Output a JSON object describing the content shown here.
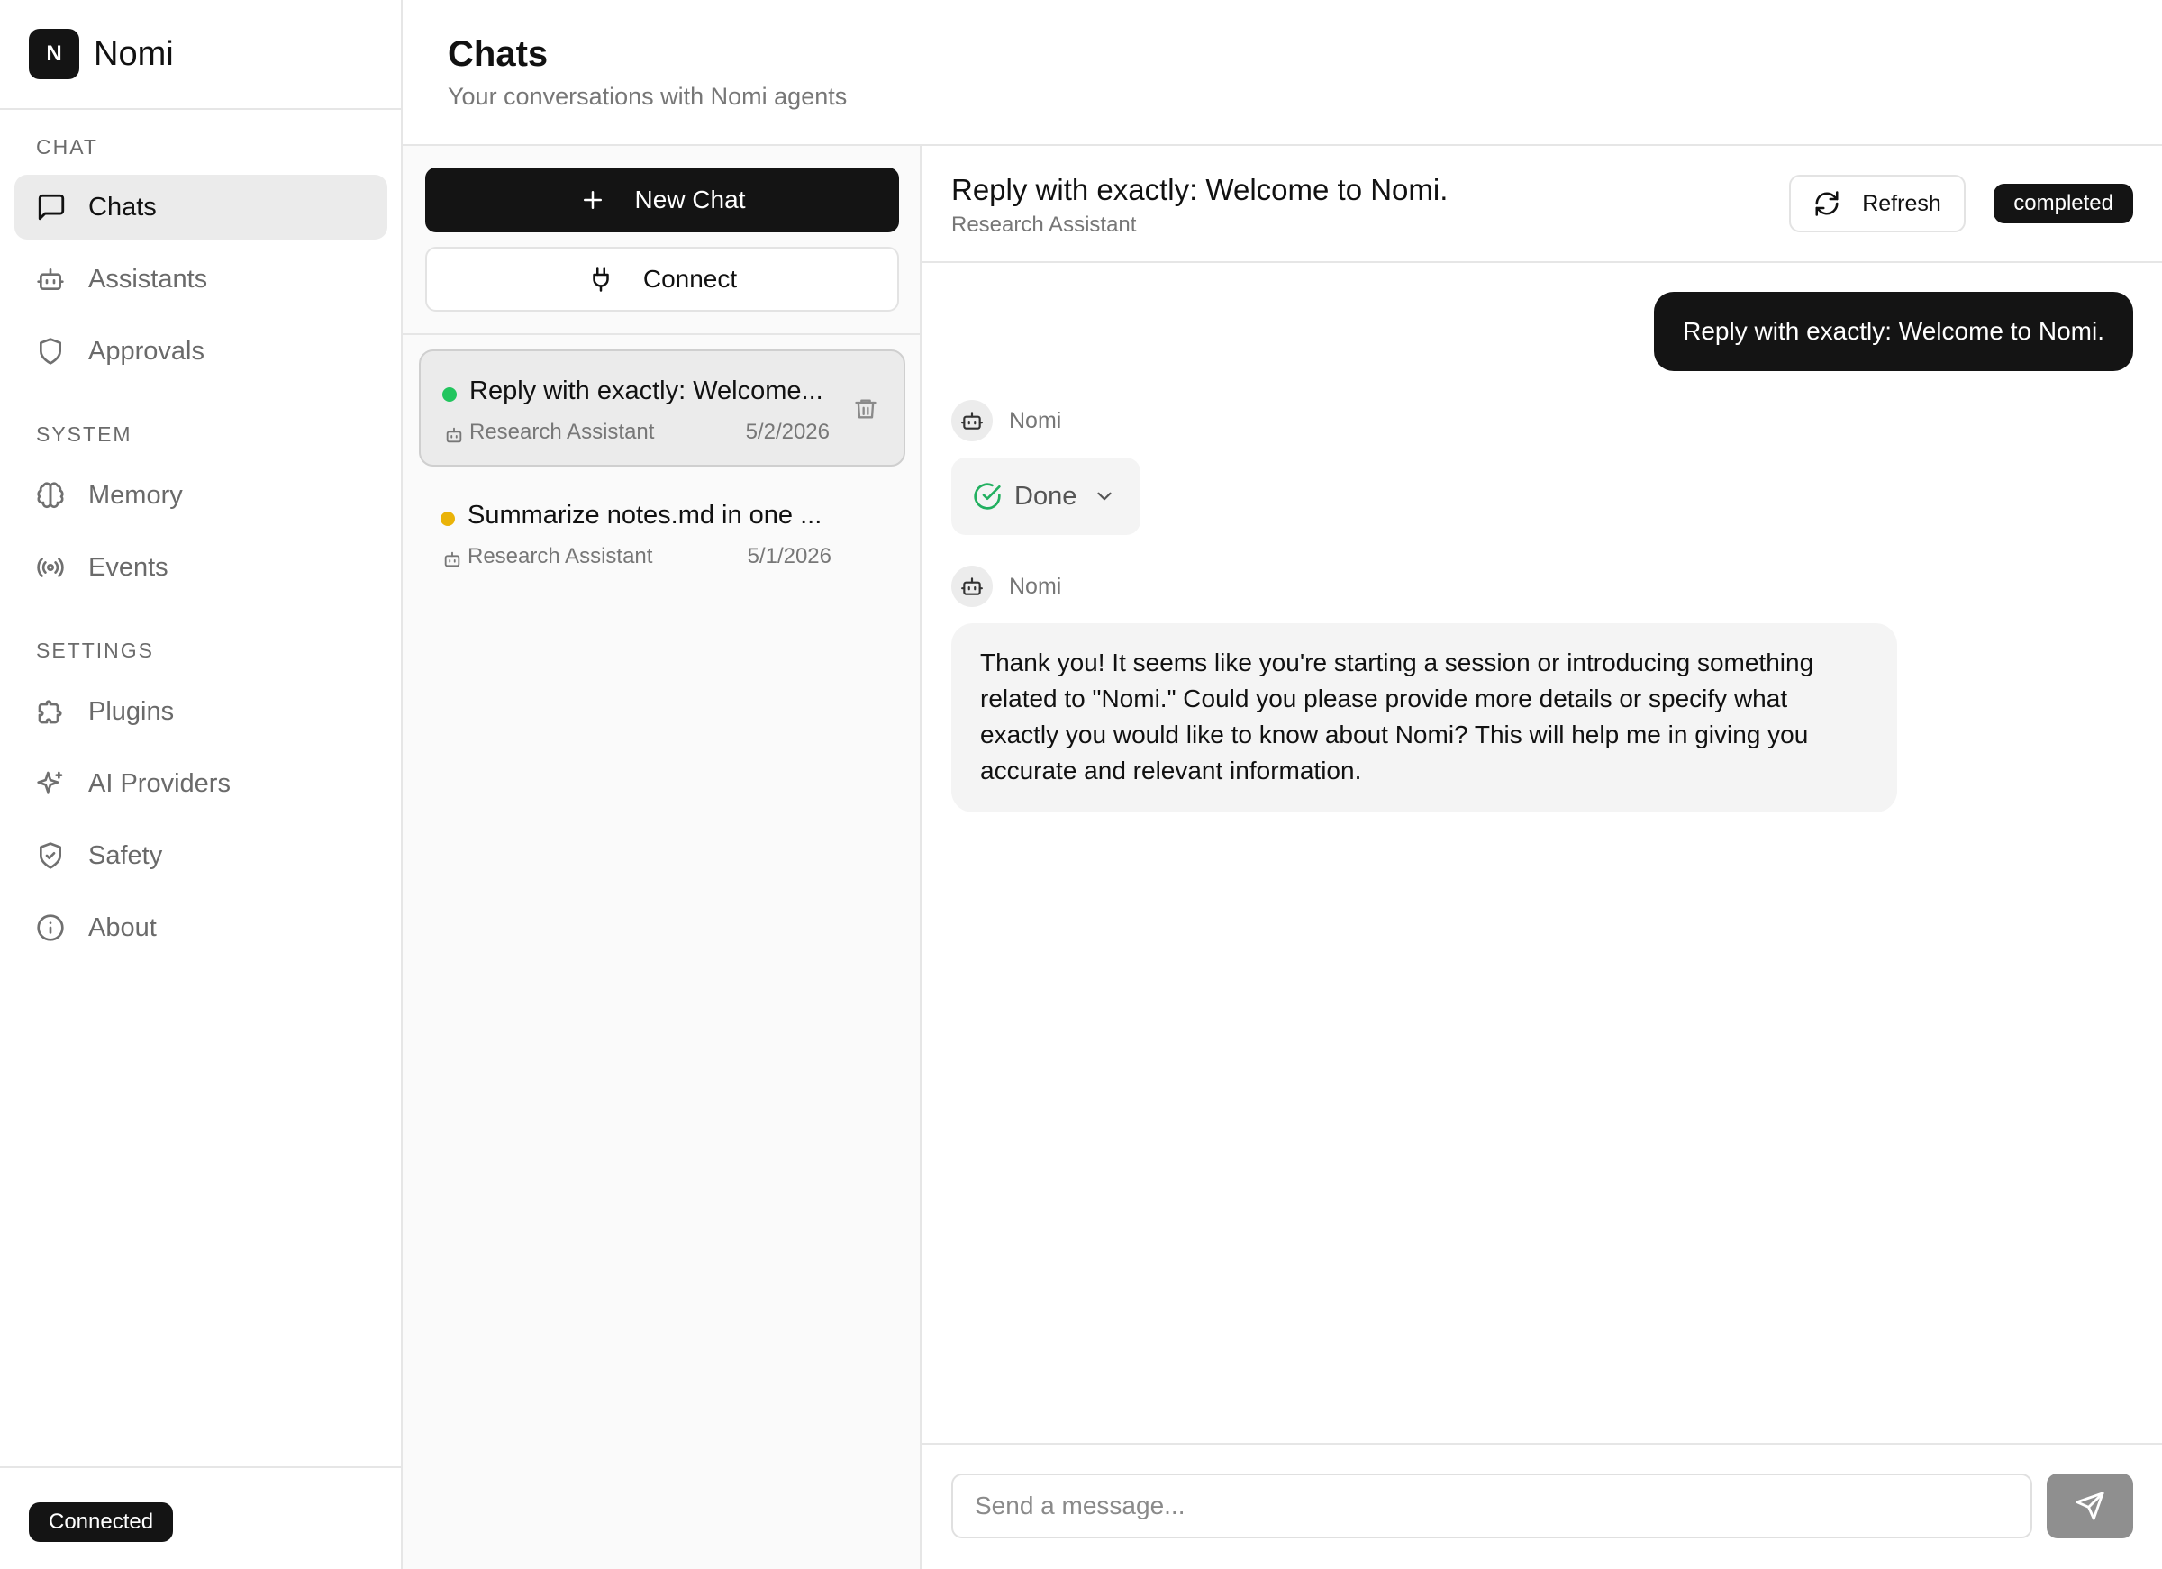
{
  "brand": {
    "logo_letter": "N",
    "name": "Nomi"
  },
  "sidebar": {
    "sections": [
      {
        "title": "CHAT",
        "items": [
          {
            "label": "Chats",
            "icon": "message-square-icon",
            "active": true
          },
          {
            "label": "Assistants",
            "icon": "bot-icon"
          },
          {
            "label": "Approvals",
            "icon": "shield-icon"
          }
        ]
      },
      {
        "title": "SYSTEM",
        "items": [
          {
            "label": "Memory",
            "icon": "brain-icon"
          },
          {
            "label": "Events",
            "icon": "radio-icon"
          }
        ]
      },
      {
        "title": "SETTINGS",
        "items": [
          {
            "label": "Plugins",
            "icon": "puzzle-icon"
          },
          {
            "label": "AI Providers",
            "icon": "sparkles-icon"
          },
          {
            "label": "Safety",
            "icon": "shield-check-icon"
          },
          {
            "label": "About",
            "icon": "info-icon"
          }
        ]
      }
    ],
    "footer": {
      "status": "Connected"
    }
  },
  "header": {
    "title": "Chats",
    "subtitle": "Your conversations with Nomi agents"
  },
  "chat_list": {
    "new_chat_label": "New Chat",
    "connect_label": "Connect",
    "items": [
      {
        "title": "Reply with exactly: Welcome...",
        "assistant": "Research Assistant",
        "date": "5/2/2026",
        "status_color": "#22c55e",
        "active": true
      },
      {
        "title": "Summarize notes.md in one ...",
        "assistant": "Research Assistant",
        "date": "5/1/2026",
        "status_color": "#eab308",
        "active": false
      }
    ]
  },
  "conversation": {
    "title": "Reply with exactly: Welcome to Nomi.",
    "subtitle": "Research Assistant",
    "refresh_label": "Refresh",
    "status": "completed",
    "user_message": "Reply with exactly: Welcome to Nomi.",
    "agent_name": "Nomi",
    "tool_status": "Done",
    "agent_message": "Thank you! It seems like you're starting a session or introducing something related to \"Nomi.\" Could you please provide more details or specify what exactly you would like to know about Nomi? This will help me in giving you accurate and relevant information.",
    "input_placeholder": "Send a message...",
    "input_value": ""
  },
  "colors": {
    "primary": "#141414",
    "success": "#22c55e",
    "warning": "#eab308",
    "muted": "#777777"
  }
}
